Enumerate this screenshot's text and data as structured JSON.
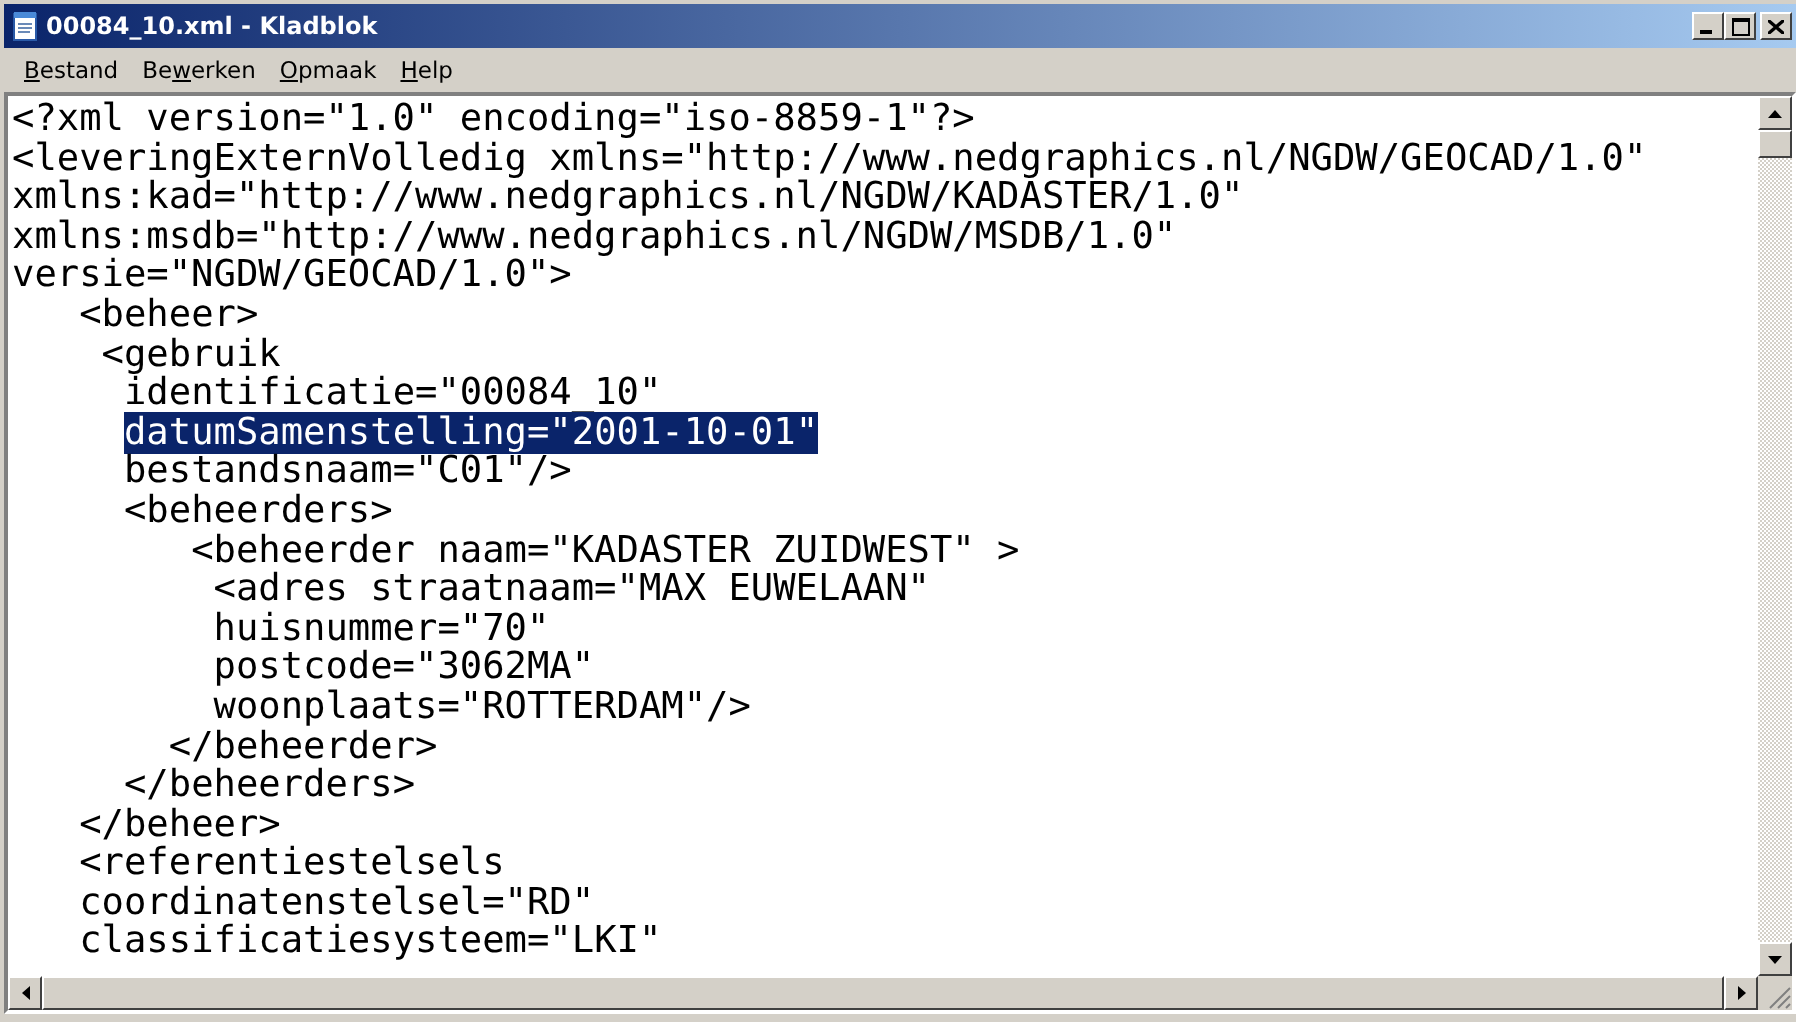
{
  "window": {
    "title": "00084_10.xml - Kladblok"
  },
  "menu": [
    {
      "key": "B",
      "after": "estand"
    },
    {
      "before": "Be",
      "key": "w",
      "after": "erken"
    },
    {
      "key": "O",
      "after": "pmaak"
    },
    {
      "key": "H",
      "after": "elp"
    }
  ],
  "editor": {
    "lines": [
      {
        "text": "<?xml version=\"1.0\" encoding=\"iso-8859-1\"?>",
        "selected": false
      },
      {
        "text": "<leveringExternVolledig xmlns=\"http://www.nedgraphics.nl/NGDW/GEOCAD/1.0\"",
        "selected": false
      },
      {
        "text": "xmlns:kad=\"http://www.nedgraphics.nl/NGDW/KADASTER/1.0\"",
        "selected": false
      },
      {
        "text": "xmlns:msdb=\"http://www.nedgraphics.nl/NGDW/MSDB/1.0\"",
        "selected": false
      },
      {
        "text": "versie=\"NGDW/GEOCAD/1.0\">",
        "selected": false
      },
      {
        "text": "   <beheer>",
        "selected": false
      },
      {
        "text": "    <gebruik",
        "selected": false
      },
      {
        "text": "     identificatie=\"00084_10\"",
        "selected": false
      },
      {
        "text": "     datumSamenstelling=\"2001-10-01\"",
        "selected": true
      },
      {
        "text": "     bestandsnaam=\"C01\"/>",
        "selected": false
      },
      {
        "text": "     <beheerders>",
        "selected": false
      },
      {
        "text": "        <beheerder naam=\"KADASTER ZUIDWEST\" >",
        "selected": false
      },
      {
        "text": "         <adres straatnaam=\"MAX EUWELAAN\"",
        "selected": false
      },
      {
        "text": "         huisnummer=\"70\"",
        "selected": false
      },
      {
        "text": "         postcode=\"3062MA\"",
        "selected": false
      },
      {
        "text": "         woonplaats=\"ROTTERDAM\"/>",
        "selected": false
      },
      {
        "text": "       </beheerder>",
        "selected": false
      },
      {
        "text": "     </beheerders>",
        "selected": false
      },
      {
        "text": "   </beheer>",
        "selected": false
      },
      {
        "text": "   <referentiestelsels",
        "selected": false
      },
      {
        "text": "   coordinatenstelsel=\"RD\"",
        "selected": false
      },
      {
        "text": "   classificatiesysteem=\"LKI\"",
        "selected": false
      }
    ]
  }
}
